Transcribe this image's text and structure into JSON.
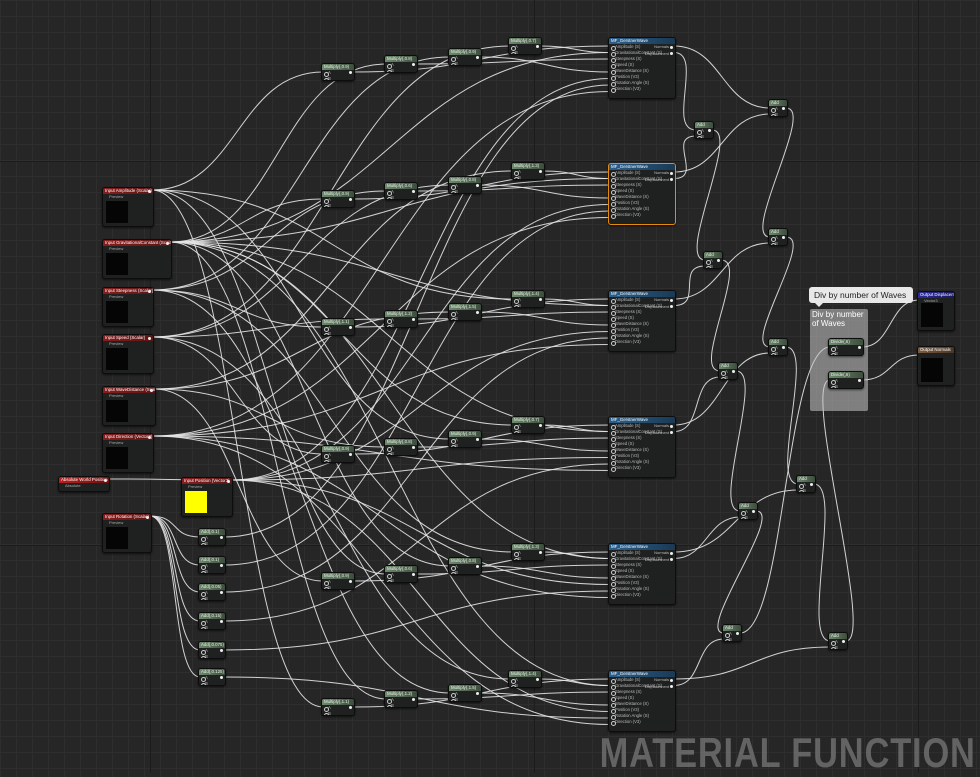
{
  "watermark": "MATERIAL FUNCTION",
  "comment": {
    "title": "Div by number of Waves",
    "bubble": "Div by number of Waves"
  },
  "preview_label": "Preview",
  "colors": {
    "background": "#262626",
    "wire": "#e6e6e6",
    "selection": "#e28a12",
    "position_preview": "#ffff00"
  },
  "inputs": [
    {
      "id": "in_amp",
      "label": "Input Amplitude (Scalar)"
    },
    {
      "id": "in_grav",
      "label": "Input GravitationalConstant (Scalar)"
    },
    {
      "id": "in_steep",
      "label": "Input Steepness (Scalar)"
    },
    {
      "id": "in_speed",
      "label": "Input Speed (Scalar)"
    },
    {
      "id": "in_wlen",
      "label": "Input WaveDistance (Scalar)"
    },
    {
      "id": "in_dir",
      "label": "Input Direction (Vector3)"
    },
    {
      "id": "in_wp",
      "label": "Absolute World Position",
      "sub": "Absolute"
    },
    {
      "id": "in_pos",
      "label": "Input Position (Vector3)"
    },
    {
      "id": "in_rot",
      "label": "Input Rotation (Scalar)"
    }
  ],
  "mf_title": "MF_GerstnerWave",
  "mf_pins": [
    "Amplitude (S)",
    "GravitationalConstant (S)",
    "Steepness (S)",
    "Speed (S)",
    "WaveDistance (S)",
    "Position (V3)",
    "Rotation Angle (S)",
    "Direction (V3)"
  ],
  "mf_outputs": [
    "Normals",
    "Displacement"
  ],
  "mult_labels": [
    "Multiply(,0.9)",
    "Multiply(,0.8)",
    "Multiply(,0.9)",
    "Multiply(,0.7)",
    "Multiply(,0.9)",
    "Multiply(,0.6)",
    "Multiply(,0.8)",
    "Multiply(,1.3)",
    "Multiply(,1.1)",
    "Multiply(,1.2)",
    "Multiply(,1.5)",
    "Multiply(,1.4)"
  ],
  "add_labels": [
    "Add(,0.1)",
    "Add(,0.1)",
    "Add(,0.05)",
    "Add(,0.15)",
    "Add(,0.075)",
    "Add(,0.125)"
  ],
  "add_node_label": "Add",
  "divide_label": "Divide(,6)",
  "outputs": [
    {
      "label": "Output Displacement",
      "sub": "Vector3"
    },
    {
      "label": "Output Normals"
    }
  ]
}
